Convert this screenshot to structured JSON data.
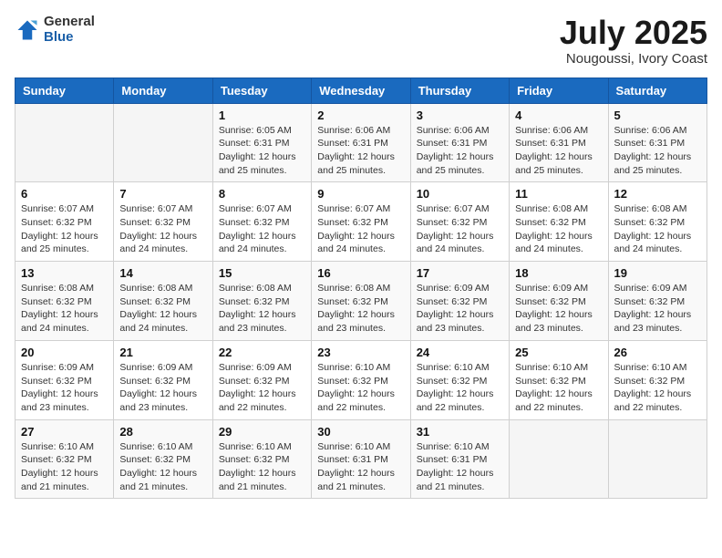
{
  "logo": {
    "general": "General",
    "blue": "Blue"
  },
  "header": {
    "title": "July 2025",
    "location": "Nougoussi, Ivory Coast"
  },
  "weekdays": [
    "Sunday",
    "Monday",
    "Tuesday",
    "Wednesday",
    "Thursday",
    "Friday",
    "Saturday"
  ],
  "weeks": [
    [
      {
        "day": "",
        "sunrise": "",
        "sunset": "",
        "daylight": ""
      },
      {
        "day": "",
        "sunrise": "",
        "sunset": "",
        "daylight": ""
      },
      {
        "day": "1",
        "sunrise": "Sunrise: 6:05 AM",
        "sunset": "Sunset: 6:31 PM",
        "daylight": "Daylight: 12 hours and 25 minutes."
      },
      {
        "day": "2",
        "sunrise": "Sunrise: 6:06 AM",
        "sunset": "Sunset: 6:31 PM",
        "daylight": "Daylight: 12 hours and 25 minutes."
      },
      {
        "day": "3",
        "sunrise": "Sunrise: 6:06 AM",
        "sunset": "Sunset: 6:31 PM",
        "daylight": "Daylight: 12 hours and 25 minutes."
      },
      {
        "day": "4",
        "sunrise": "Sunrise: 6:06 AM",
        "sunset": "Sunset: 6:31 PM",
        "daylight": "Daylight: 12 hours and 25 minutes."
      },
      {
        "day": "5",
        "sunrise": "Sunrise: 6:06 AM",
        "sunset": "Sunset: 6:31 PM",
        "daylight": "Daylight: 12 hours and 25 minutes."
      }
    ],
    [
      {
        "day": "6",
        "sunrise": "Sunrise: 6:07 AM",
        "sunset": "Sunset: 6:32 PM",
        "daylight": "Daylight: 12 hours and 25 minutes."
      },
      {
        "day": "7",
        "sunrise": "Sunrise: 6:07 AM",
        "sunset": "Sunset: 6:32 PM",
        "daylight": "Daylight: 12 hours and 24 minutes."
      },
      {
        "day": "8",
        "sunrise": "Sunrise: 6:07 AM",
        "sunset": "Sunset: 6:32 PM",
        "daylight": "Daylight: 12 hours and 24 minutes."
      },
      {
        "day": "9",
        "sunrise": "Sunrise: 6:07 AM",
        "sunset": "Sunset: 6:32 PM",
        "daylight": "Daylight: 12 hours and 24 minutes."
      },
      {
        "day": "10",
        "sunrise": "Sunrise: 6:07 AM",
        "sunset": "Sunset: 6:32 PM",
        "daylight": "Daylight: 12 hours and 24 minutes."
      },
      {
        "day": "11",
        "sunrise": "Sunrise: 6:08 AM",
        "sunset": "Sunset: 6:32 PM",
        "daylight": "Daylight: 12 hours and 24 minutes."
      },
      {
        "day": "12",
        "sunrise": "Sunrise: 6:08 AM",
        "sunset": "Sunset: 6:32 PM",
        "daylight": "Daylight: 12 hours and 24 minutes."
      }
    ],
    [
      {
        "day": "13",
        "sunrise": "Sunrise: 6:08 AM",
        "sunset": "Sunset: 6:32 PM",
        "daylight": "Daylight: 12 hours and 24 minutes."
      },
      {
        "day": "14",
        "sunrise": "Sunrise: 6:08 AM",
        "sunset": "Sunset: 6:32 PM",
        "daylight": "Daylight: 12 hours and 24 minutes."
      },
      {
        "day": "15",
        "sunrise": "Sunrise: 6:08 AM",
        "sunset": "Sunset: 6:32 PM",
        "daylight": "Daylight: 12 hours and 23 minutes."
      },
      {
        "day": "16",
        "sunrise": "Sunrise: 6:08 AM",
        "sunset": "Sunset: 6:32 PM",
        "daylight": "Daylight: 12 hours and 23 minutes."
      },
      {
        "day": "17",
        "sunrise": "Sunrise: 6:09 AM",
        "sunset": "Sunset: 6:32 PM",
        "daylight": "Daylight: 12 hours and 23 minutes."
      },
      {
        "day": "18",
        "sunrise": "Sunrise: 6:09 AM",
        "sunset": "Sunset: 6:32 PM",
        "daylight": "Daylight: 12 hours and 23 minutes."
      },
      {
        "day": "19",
        "sunrise": "Sunrise: 6:09 AM",
        "sunset": "Sunset: 6:32 PM",
        "daylight": "Daylight: 12 hours and 23 minutes."
      }
    ],
    [
      {
        "day": "20",
        "sunrise": "Sunrise: 6:09 AM",
        "sunset": "Sunset: 6:32 PM",
        "daylight": "Daylight: 12 hours and 23 minutes."
      },
      {
        "day": "21",
        "sunrise": "Sunrise: 6:09 AM",
        "sunset": "Sunset: 6:32 PM",
        "daylight": "Daylight: 12 hours and 23 minutes."
      },
      {
        "day": "22",
        "sunrise": "Sunrise: 6:09 AM",
        "sunset": "Sunset: 6:32 PM",
        "daylight": "Daylight: 12 hours and 22 minutes."
      },
      {
        "day": "23",
        "sunrise": "Sunrise: 6:10 AM",
        "sunset": "Sunset: 6:32 PM",
        "daylight": "Daylight: 12 hours and 22 minutes."
      },
      {
        "day": "24",
        "sunrise": "Sunrise: 6:10 AM",
        "sunset": "Sunset: 6:32 PM",
        "daylight": "Daylight: 12 hours and 22 minutes."
      },
      {
        "day": "25",
        "sunrise": "Sunrise: 6:10 AM",
        "sunset": "Sunset: 6:32 PM",
        "daylight": "Daylight: 12 hours and 22 minutes."
      },
      {
        "day": "26",
        "sunrise": "Sunrise: 6:10 AM",
        "sunset": "Sunset: 6:32 PM",
        "daylight": "Daylight: 12 hours and 22 minutes."
      }
    ],
    [
      {
        "day": "27",
        "sunrise": "Sunrise: 6:10 AM",
        "sunset": "Sunset: 6:32 PM",
        "daylight": "Daylight: 12 hours and 21 minutes."
      },
      {
        "day": "28",
        "sunrise": "Sunrise: 6:10 AM",
        "sunset": "Sunset: 6:32 PM",
        "daylight": "Daylight: 12 hours and 21 minutes."
      },
      {
        "day": "29",
        "sunrise": "Sunrise: 6:10 AM",
        "sunset": "Sunset: 6:32 PM",
        "daylight": "Daylight: 12 hours and 21 minutes."
      },
      {
        "day": "30",
        "sunrise": "Sunrise: 6:10 AM",
        "sunset": "Sunset: 6:31 PM",
        "daylight": "Daylight: 12 hours and 21 minutes."
      },
      {
        "day": "31",
        "sunrise": "Sunrise: 6:10 AM",
        "sunset": "Sunset: 6:31 PM",
        "daylight": "Daylight: 12 hours and 21 minutes."
      },
      {
        "day": "",
        "sunrise": "",
        "sunset": "",
        "daylight": ""
      },
      {
        "day": "",
        "sunrise": "",
        "sunset": "",
        "daylight": ""
      }
    ]
  ]
}
